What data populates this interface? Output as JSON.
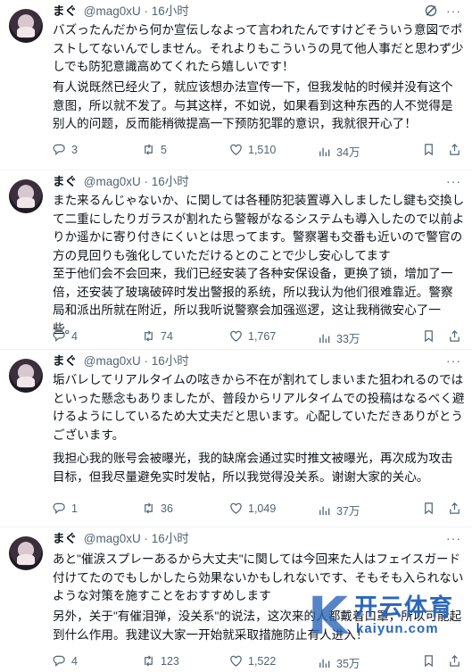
{
  "tweets": [
    {
      "name": "まぐ",
      "handle": "@mag0xU",
      "time": "· 16小时",
      "text_ja": "バズったんだから何か宣伝しなよって言われたんですけどそういう意図でポストしてないんでしません。それよりもこういうの見て他人事だと思わず少しでも防犯意識高めてくれたら嬉しいです！",
      "text_zh": "有人说既然已经火了，就应该想办法宣传一下，但我发帖的时候并没有这个意图，所以就不发了。与其这样，不如说，如果看到这种东西的人不觉得是别人的问题，反而能稍微提高一下预防犯罪的意识，我就很开心了！",
      "replies": "3",
      "retweets": "5",
      "likes": "1,510",
      "views": "34万"
    },
    {
      "name": "まぐ",
      "handle": "@mag0xU",
      "time": "· 16小时",
      "text_ja": "また来るんじゃないか、に関しては各種防犯装置導入しましたし鍵も交換して二重にしたりガラスが割れたら警報がなるシステムも導入したので以前よりか遥かに寄り付きにくいとは思ってます。警察署も交番も近いので警官の方の見回りも強化していただけるとのことで少し安心してます",
      "text_zh": "至于他们会不会回来，我们已经安装了各种安保设备，更换了锁，增加了一倍，还安装了玻璃破碎时发出警报的系统，所以我认为他们很难靠近。警察局和派出所就在附近，所以我听说警察会加强巡逻，这让我稍微安心了一些。",
      "replies": "4",
      "retweets": "74",
      "likes": "1,767",
      "views": "33万"
    },
    {
      "name": "まぐ",
      "handle": "@mag0xU",
      "time": "· 16小时",
      "text_ja": "垢バレしてリアルタイムの呟きから不在が割れてしまいまた狙われるのではといった懸念もありましたが、普段からリアルタイムでの投稿はなるべく避けるようにしているため大丈夫だと思います。心配していただきありがとうございます。",
      "text_zh": "我担心我的账号会被曝光，我的缺席会通过实时推文被曝光，再次成为攻击目标，但我尽量避免实时发帖，所以我觉得没关系。谢谢大家的关心。",
      "replies": "1",
      "retweets": "36",
      "likes": "1,049",
      "views": "37万"
    },
    {
      "name": "まぐ",
      "handle": "@mag0xU",
      "time": "· 16小时",
      "text_ja": "あと\"催涙スプレーあるから大丈夫\"に関しては今回来た人はフェイスガード付けてたのでもしかしたら効果ないかもしれないです、そもそも入られないような対策を施すことをおすすめします",
      "text_zh": "另外，关于\"有催泪弹，没关系\"的说法，这次来的人都戴着口罩，所以可能起到什么作用。我建议大家一开始就采取措施防止有人进入！",
      "replies": "4",
      "retweets": "123",
      "likes": "1,522",
      "views": "35万"
    }
  ],
  "watermark": {
    "mark": "K",
    "title": "开云体育",
    "url": "kaiyun.com"
  }
}
